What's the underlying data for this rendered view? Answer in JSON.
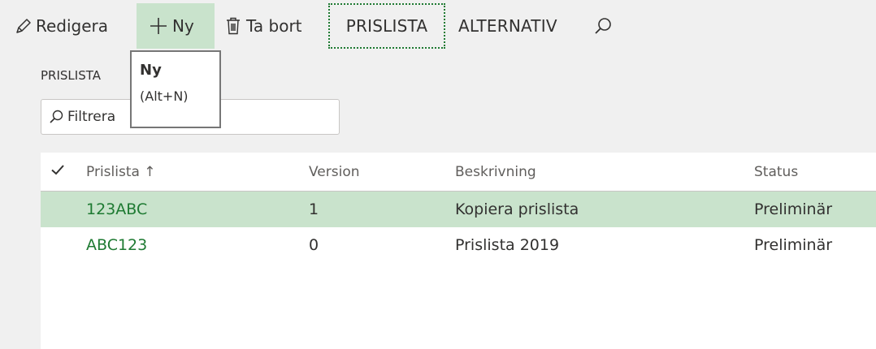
{
  "toolbar": {
    "edit_label": "Redigera",
    "new_label": "Ny",
    "delete_label": "Ta bort",
    "prislista_tab": "PRISLISTA",
    "alternativ_tab": "ALTERNATIV"
  },
  "tooltip": {
    "title": "Ny",
    "shortcut": "(Alt+N)"
  },
  "section": {
    "label": "PRISLISTA"
  },
  "filter": {
    "placeholder": "Filtrera"
  },
  "grid": {
    "columns": [
      "Prislista ↑",
      "Version",
      "Beskrivning",
      "Status"
    ],
    "rows": [
      {
        "prislista": "123ABC",
        "version": "1",
        "beskrivning": "Kopiera prislista",
        "status": "Preliminär"
      },
      {
        "prislista": "ABC123",
        "version": "0",
        "beskrivning": "Prislista 2019",
        "status": "Preliminär"
      }
    ]
  },
  "colors": {
    "accent_green": "#1e7a32",
    "selected_row": "#c9e3cc"
  },
  "icons": {
    "edit": "pencil-icon",
    "new": "plus-icon",
    "delete": "trash-icon",
    "search": "search-icon",
    "check": "checkmark-icon"
  }
}
